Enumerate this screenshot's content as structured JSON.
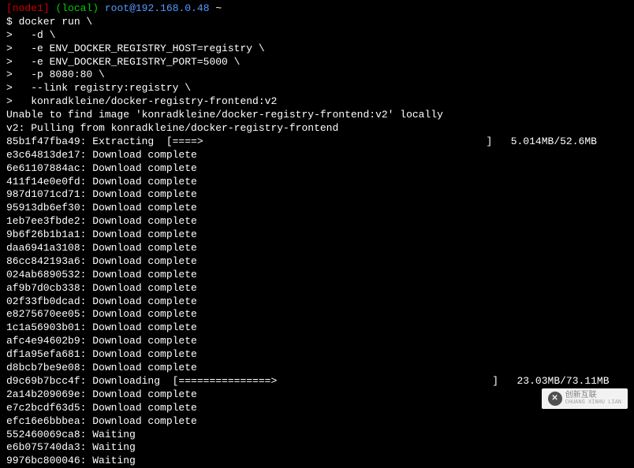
{
  "prompt": {
    "bracket_open": "[",
    "node": "node1",
    "bracket_close": "]",
    "local": "(local)",
    "userhost": "root@192.168.0.48",
    "path": "~"
  },
  "command": {
    "line0": "$ docker run \\",
    "line1": ">   -d \\",
    "line2": ">   -e ENV_DOCKER_REGISTRY_HOST=registry \\",
    "line3": ">   -e ENV_DOCKER_REGISTRY_PORT=5000 \\",
    "line4": ">   -p 8080:80 \\",
    "line5": ">   --link registry:registry \\",
    "line6": ">   konradkleine/docker-registry-frontend:v2"
  },
  "output": {
    "line0": "Unable to find image 'konradkleine/docker-registry-frontend:v2' locally",
    "line1": "v2: Pulling from konradkleine/docker-registry-frontend"
  },
  "layers": [
    {
      "id": "85b1f47fba49",
      "status": "Extracting",
      "bar": "[====>                                              ]",
      "size": "5.014MB/52.6MB"
    },
    {
      "id": "e3c64813de17",
      "status": "Download complete",
      "bar": "",
      "size": ""
    },
    {
      "id": "6e61107884ac",
      "status": "Download complete",
      "bar": "",
      "size": ""
    },
    {
      "id": "411f14e0e0fd",
      "status": "Download complete",
      "bar": "",
      "size": ""
    },
    {
      "id": "987d1071cd71",
      "status": "Download complete",
      "bar": "",
      "size": ""
    },
    {
      "id": "95913db6ef30",
      "status": "Download complete",
      "bar": "",
      "size": ""
    },
    {
      "id": "1eb7ee3fbde2",
      "status": "Download complete",
      "bar": "",
      "size": ""
    },
    {
      "id": "9b6f26b1b1a1",
      "status": "Download complete",
      "bar": "",
      "size": ""
    },
    {
      "id": "daa6941a3108",
      "status": "Download complete",
      "bar": "",
      "size": ""
    },
    {
      "id": "86cc842193a6",
      "status": "Download complete",
      "bar": "",
      "size": ""
    },
    {
      "id": "024ab6890532",
      "status": "Download complete",
      "bar": "",
      "size": ""
    },
    {
      "id": "af9b7d0cb338",
      "status": "Download complete",
      "bar": "",
      "size": ""
    },
    {
      "id": "02f33fb0dcad",
      "status": "Download complete",
      "bar": "",
      "size": ""
    },
    {
      "id": "e8275670ee05",
      "status": "Download complete",
      "bar": "",
      "size": ""
    },
    {
      "id": "1c1a56903b01",
      "status": "Download complete",
      "bar": "",
      "size": ""
    },
    {
      "id": "afc4e94602b9",
      "status": "Download complete",
      "bar": "",
      "size": ""
    },
    {
      "id": "df1a95efa681",
      "status": "Download complete",
      "bar": "",
      "size": ""
    },
    {
      "id": "d8bcb7be9e08",
      "status": "Download complete",
      "bar": "",
      "size": ""
    },
    {
      "id": "d9c69b7bcc4f",
      "status": "Downloading",
      "bar": "[===============>                                   ]",
      "size": "23.03MB/73.11MB"
    },
    {
      "id": "2a14b209069e",
      "status": "Download complete",
      "bar": "",
      "size": ""
    },
    {
      "id": "e7c2bcdf63d5",
      "status": "Download complete",
      "bar": "",
      "size": ""
    },
    {
      "id": "efc16e6bbbea",
      "status": "Download complete",
      "bar": "",
      "size": ""
    },
    {
      "id": "552460069ca8",
      "status": "Waiting",
      "bar": "",
      "size": ""
    },
    {
      "id": "e6b075740da3",
      "status": "Waiting",
      "bar": "",
      "size": ""
    },
    {
      "id": "9976bc800046",
      "status": "Waiting",
      "bar": "",
      "size": ""
    }
  ],
  "watermark": {
    "title": "创新互联",
    "sub": "CHUANG XINHU LIAN"
  }
}
